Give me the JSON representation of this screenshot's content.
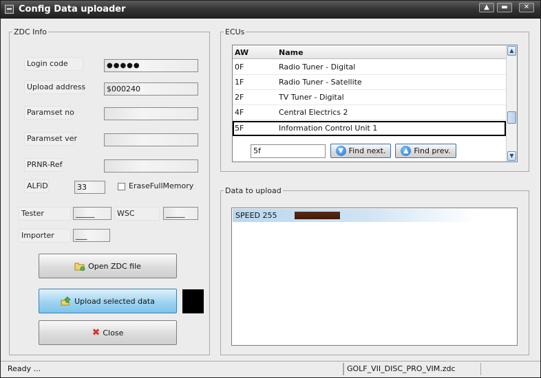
{
  "window": {
    "title": "Config Data uploader",
    "controls": [
      "▲",
      "▬",
      "✕"
    ]
  },
  "zdc": {
    "legend": "ZDC Info",
    "login_code_label": "Login code",
    "login_code_value": "●●●●●",
    "upload_address_label": "Upload address",
    "upload_address_value": "$000240",
    "paramset_no_label": "Paramset no",
    "paramset_no_value": "",
    "paramset_ver_label": "Paramset ver",
    "paramset_ver_value": "",
    "prnr_ref_label": "PRNR-Ref",
    "prnr_ref_value": "",
    "alfid_label": "ALFiD",
    "alfid_value": "33",
    "erase_full_memory_label": "EraseFullMemory",
    "tester_label": "Tester",
    "tester_value": "_____",
    "wsc_label": "WSC",
    "wsc_value": "_____",
    "importer_label": "Importer",
    "importer_value": "___"
  },
  "buttons": {
    "open_zdc": "Open ZDC file",
    "upload_selected": "Upload selected data",
    "close": "Close"
  },
  "ecus": {
    "legend": "ECUs",
    "columns": {
      "aw": "AW",
      "name": "Name"
    },
    "rows": [
      {
        "aw": "0F",
        "name": "Radio Tuner - Digital"
      },
      {
        "aw": "1F",
        "name": "Radio Tuner - Satellite"
      },
      {
        "aw": "2F",
        "name": "TV Tuner - Digital"
      },
      {
        "aw": "4F",
        "name": "Central Electrics 2"
      },
      {
        "aw": "5F",
        "name": "Information Control Unit 1"
      }
    ],
    "selected_index": 4,
    "search_value": "5f",
    "find_next": "Find next.",
    "find_prev": "Find prev."
  },
  "upload_data": {
    "legend": "Data to upload",
    "items": [
      {
        "label": "SPEED 255"
      }
    ]
  },
  "status": {
    "message": "Ready ...",
    "file": "GOLF_VII_DISC_PRO_VIM.zdc"
  },
  "colors": {
    "title_bar": "#2e2e2e",
    "upload_button": "#9fd4f0",
    "data_bar": "#4a2210",
    "selection_border": "#000000"
  }
}
